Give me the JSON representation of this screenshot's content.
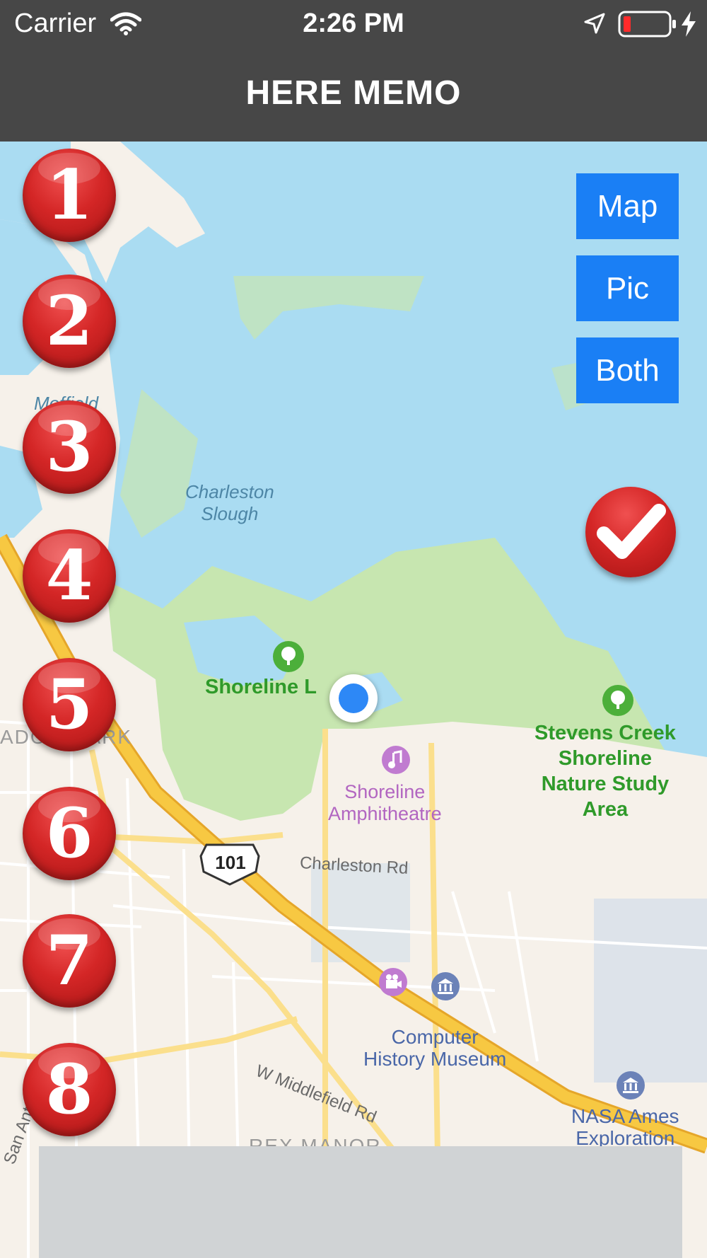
{
  "status_bar": {
    "carrier": "Carrier",
    "time": "2:26 PM",
    "icons": [
      "wifi-icon",
      "location-arrow-icon",
      "battery-low-icon",
      "charging-bolt-icon"
    ]
  },
  "header": {
    "title": "HERE MEMO"
  },
  "memo_buttons": [
    "1",
    "2",
    "3",
    "4",
    "5",
    "6",
    "7",
    "8"
  ],
  "mode_buttons": {
    "map": "Map",
    "pic": "Pic",
    "both": "Both"
  },
  "confirm_button": {
    "icon": "checkmark-icon"
  },
  "map": {
    "labels": {
      "slough": "Charleston\nSlough",
      "moffield": "Moffield",
      "park1": "Shoreline L",
      "park2": "Stevens Creek\nShoreline\nNature Study\nArea",
      "amphitheatre": "Shoreline\nAmphitheatre",
      "charleston_rd": "Charleston Rd",
      "museum": "Computer\nHistory Museum",
      "middlefield": "W Middlefield Rd",
      "nasa": "NASA Ames\nExploration",
      "meadow_park": "ADOW PARK",
      "highway": "101",
      "san_antonio": "San Anton",
      "rex_manor": "REX MANOR"
    },
    "colors": {
      "water": "#aadcf2",
      "park": "#c7e6b0",
      "land": "#f6f1ea",
      "highway": "#f7c842"
    }
  },
  "ad_banner": {
    "text": ""
  },
  "colors": {
    "header": "#474747",
    "accent": "#1a7ff5",
    "badge_red": "#d42626"
  }
}
